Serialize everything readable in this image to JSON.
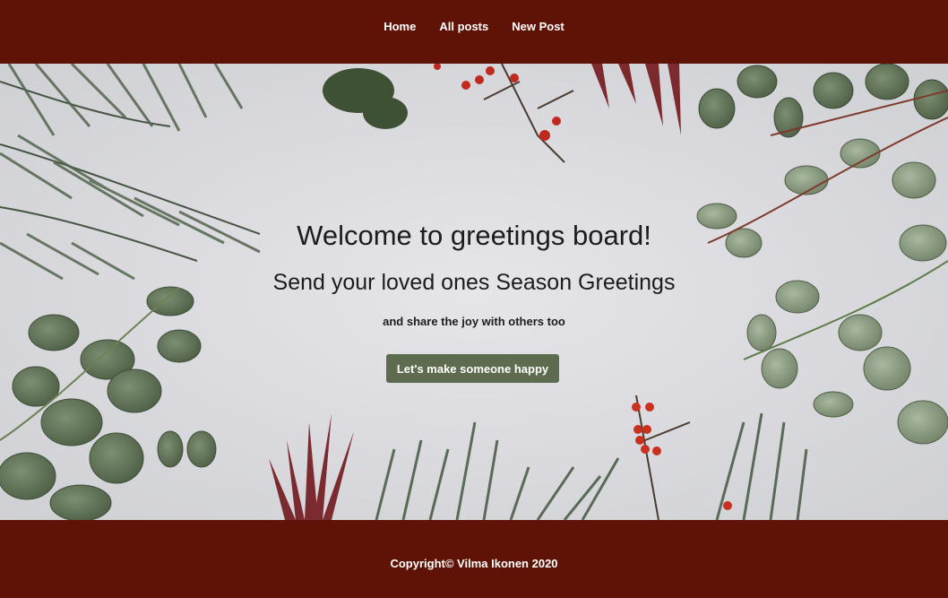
{
  "nav": {
    "items": [
      {
        "label": "Home"
      },
      {
        "label": "All posts"
      },
      {
        "label": "New Post"
      }
    ]
  },
  "hero": {
    "title": "Welcome to greetings board!",
    "subtitle": "Send your loved ones Season Greetings",
    "tagline": "and share the joy with others too",
    "cta_label": "Let's make someone happy",
    "background_image": "christmas-greenery-frame"
  },
  "footer": {
    "copyright": "Copyright© Vilma Ikonen 2020"
  },
  "colors": {
    "header_bg": "#5f1306",
    "footer_bg": "#5f1306",
    "cta_bg": "#5d6b4f",
    "text_dark": "#1c1c1c",
    "text_light": "#ffffff"
  }
}
